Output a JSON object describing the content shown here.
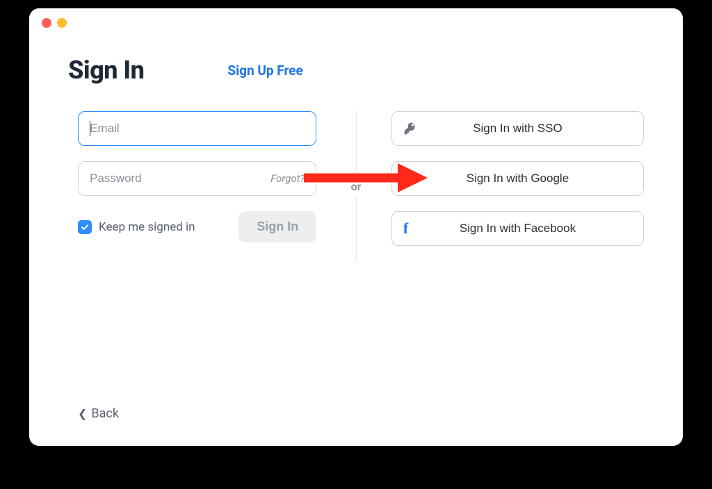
{
  "header": {
    "title": "Sign In",
    "signup_link": "Sign Up Free"
  },
  "form": {
    "email_placeholder": "Email",
    "password_placeholder": "Password",
    "forgot_label": "Forgot?",
    "keep_signed_in_label": "Keep me signed in",
    "keep_signed_in_checked": true,
    "signin_button": "Sign In"
  },
  "divider": {
    "or": "or"
  },
  "social": {
    "sso_label": "Sign In with SSO",
    "google_label": "Sign In with Google",
    "facebook_label": "Sign In with Facebook"
  },
  "footer": {
    "back_label": "Back"
  },
  "colors": {
    "accent": "#2d8cff",
    "annotation": "#ff2a1a"
  }
}
